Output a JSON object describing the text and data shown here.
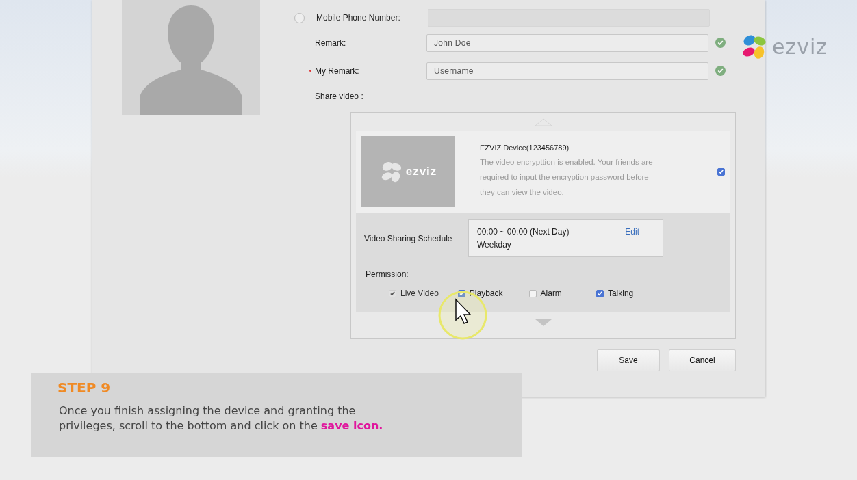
{
  "logo": {
    "text": "ezviz"
  },
  "form": {
    "fields": [
      {
        "kind": "radio",
        "label": "Mobile Phone Number:",
        "selected": false,
        "disabled": true
      },
      {
        "kind": "text",
        "label": "Remark:",
        "value": "John Doe",
        "valid": true,
        "required": false
      },
      {
        "kind": "text",
        "label": "My Remark:",
        "value": "Username",
        "valid": true,
        "required": true
      }
    ],
    "share_label": "Share video :"
  },
  "device": {
    "thumbnail_logo": "ezviz",
    "name": "EZVIZ Device(123456789)",
    "description": "The video encrypttion is enabled. Your friends are required to input the encryption password before they can view the video.",
    "checked": true
  },
  "schedule": {
    "label": "Video Sharing Schedule",
    "time": "00:00 ~ 00:00 (Next Day)",
    "days": "Weekday",
    "edit": "Edit"
  },
  "permission": {
    "label": "Permission:",
    "items": [
      {
        "label": "Live Video",
        "checked": true,
        "disabled": true
      },
      {
        "label": "Playback",
        "checked": true,
        "disabled": false
      },
      {
        "label": "Alarm",
        "checked": false,
        "disabled": false
      },
      {
        "label": "Talking",
        "checked": true,
        "disabled": false
      }
    ]
  },
  "buttons": [
    "Save",
    "Cancel"
  ],
  "caption": {
    "title": "STEP 9",
    "text": "Once you finish assigning the device and granting the privileges, scroll to the bottom and click on the **save icon.**"
  }
}
